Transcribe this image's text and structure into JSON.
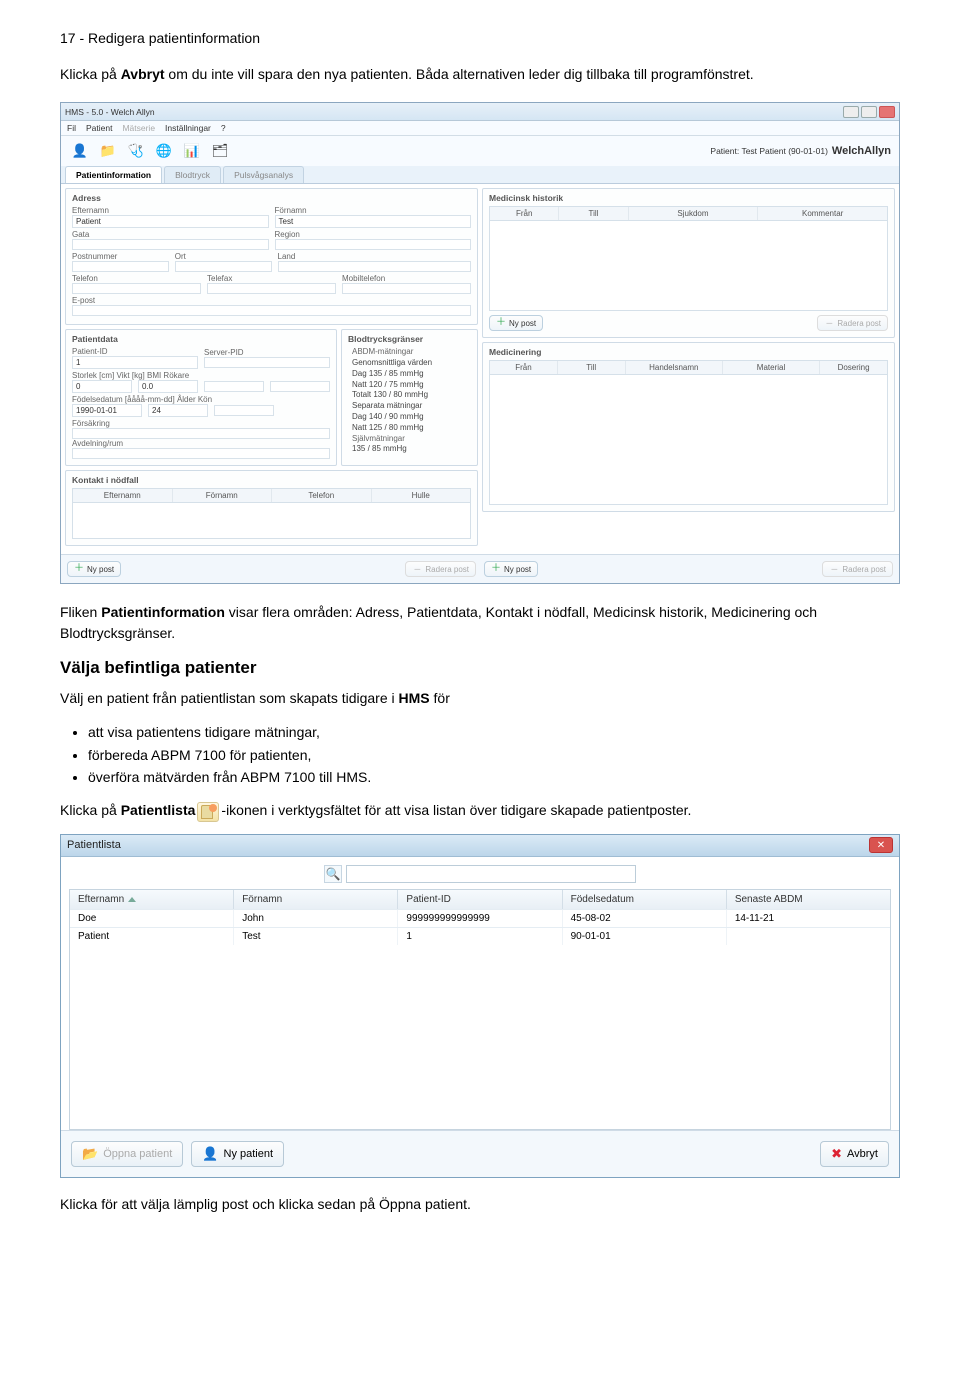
{
  "page": {
    "header": "17 - Redigera patientinformation",
    "intro_prefix": "Klicka på ",
    "intro_bold": "Avbryt",
    "intro_suffix": " om du inte vill spara den nya patienten. Båda alternativen leder dig tillbaka till programfönstret."
  },
  "main_window": {
    "title": "HMS - 5.0 - Welch Allyn",
    "menu": {
      "file": "Fil",
      "patient": "Patient",
      "matserie": "Mätserie",
      "installningar": "Inställningar",
      "help": "?"
    },
    "patient_label": "Patient: Test Patient (90-01-01)",
    "brand": "WelchAllyn",
    "tabs": {
      "info": "Patientinformation",
      "bp": "Blodtryck",
      "pwa": "Pulsvågsanalys"
    },
    "adress": {
      "title": "Adress",
      "efternamn_lbl": "Efternamn",
      "fornamn_lbl": "Förnamn",
      "efternamn": "Patient",
      "fornamn": "Test",
      "gata_lbl": "Gata",
      "region_lbl": "Region",
      "postnr_lbl": "Postnummer",
      "ort_lbl": "Ort",
      "land_lbl": "Land",
      "telefon1_lbl": "Telefon",
      "telefon2_lbl": "Telefax",
      "mobil_lbl": "Mobiltelefon",
      "epost_lbl": "E-post"
    },
    "patientdata": {
      "title": "Patientdata",
      "pid_lbl": "Patient-ID",
      "pid": "1",
      "server_lbl": "Server-PID",
      "storlek_lbl": "Storlek  [cm] Vikt  [kg] BMI          Rökare",
      "storlek": "0",
      "vikt": "0.0",
      "fdatum_lbl": "Födelsedatum [åååå-mm-dd] Ålder  Kön",
      "fdatum": "1990-01-01",
      "alder": "24",
      "forsakring_lbl": "Försäkring",
      "avdelning_lbl": "Avdelning/rum"
    },
    "bp_title": "Blodtrycksgränser",
    "bp_abdm": "ABDM-mätningar",
    "bp_avg": "Genomsnittliga värden",
    "bp_dag": "Dag  135 / 85 mmHg",
    "bp_natt": "Natt  120 / 75 mmHg",
    "bp_totalt": "Totalt 130 / 80 mmHg",
    "bp_sep": "Separata mätningar",
    "bp_dag2": "Dag  140 / 90 mmHg",
    "bp_natt2": "Natt  125 / 80 mmHg",
    "bp_self": "Självmätningar",
    "bp_self_val": "135 / 85 mmHg",
    "kontakt": {
      "title": "Kontakt i nödfall",
      "efternamn": "Efternamn",
      "fornamn": "Förnamn",
      "telefon": "Telefon",
      "hulle": "Hulle"
    },
    "medhist": {
      "title": "Medicinsk historik",
      "fran": "Från",
      "till": "Till",
      "sjukdom": "Sjukdom",
      "kommentar": "Kommentar"
    },
    "medicinering": {
      "title": "Medicinering",
      "fran": "Från",
      "till": "Till",
      "handel": "Handelsnamn",
      "material": "Material",
      "dosering": "Dosering"
    },
    "btn_ny": "Ny post",
    "btn_radera": "Radera post"
  },
  "mid_text": {
    "prefix": "Fliken ",
    "b1": "Patientinformation",
    "rest": " visar flera områden: Adress, Patientdata, Kontakt i nödfall, Medicinsk historik, Medicinering och Blodtrycksgränser."
  },
  "section_heading": "Välja befintliga patienter",
  "list_intro_prefix": "Välj en patient från patientlistan som skapats tidigare i ",
  "list_intro_bold": "HMS",
  "list_intro_suffix": " för",
  "bullets": {
    "b1": "att visa patientens tidigare mätningar,",
    "b2": "förbereda ABPM 7100 för patienten,",
    "b3_prefix": "överföra mätvärden från ABPM 7100 till ",
    "b3_bold": "HMS",
    "b3_suffix": "."
  },
  "click_line": {
    "prefix": "Klicka på ",
    "bold": "Patientlista",
    "suffix": "-ikonen i verktygsfältet för att visa listan över tidigare skapade patientposter."
  },
  "patient_list": {
    "title": "Patientlista",
    "cols": {
      "efternamn": "Efternamn",
      "fornamn": "Förnamn",
      "pid": "Patient-ID",
      "fdatum": "Födelsedatum",
      "senaste": "Senaste ABDM"
    },
    "rows": [
      {
        "efternamn": "Doe",
        "fornamn": "John",
        "pid": "999999999999999",
        "fdatum": "45-08-02",
        "senaste": "14-11-21"
      },
      {
        "efternamn": "Patient",
        "fornamn": "Test",
        "pid": "1",
        "fdatum": "90-01-01",
        "senaste": ""
      }
    ],
    "btn_open": "Öppna patient",
    "btn_new": "Ny patient",
    "btn_cancel": "Avbryt"
  },
  "final_prefix": "Klicka för att välja lämplig post och klicka sedan på ",
  "final_bold": "Öppna patient",
  "final_suffix": "."
}
